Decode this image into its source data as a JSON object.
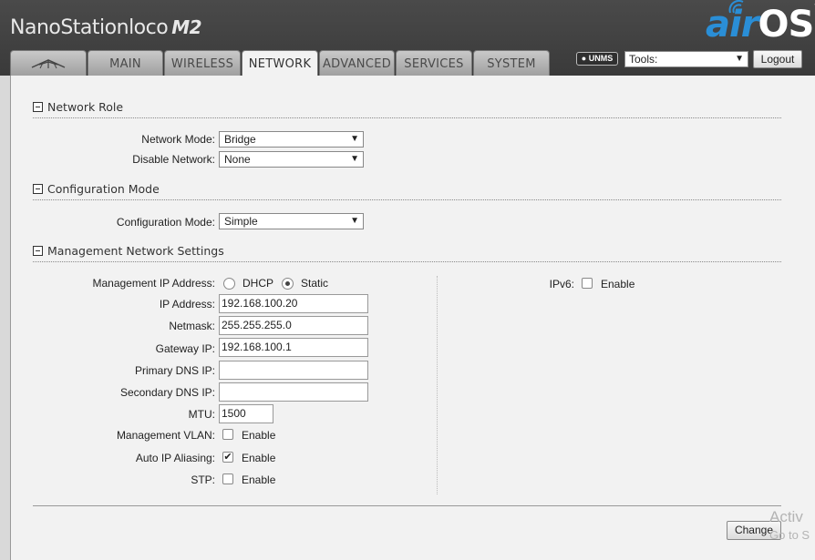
{
  "header": {
    "product_name": "NanoStation",
    "product_variant": "loco",
    "product_model": "M2",
    "brand_air": "air",
    "brand_os": "OS",
    "brand_tm": "™"
  },
  "tabs": [
    {
      "label": "",
      "icon": "ubiquiti-logo-icon"
    },
    {
      "label": "MAIN"
    },
    {
      "label": "WIRELESS"
    },
    {
      "label": "NETWORK",
      "active": true
    },
    {
      "label": "ADVANCED"
    },
    {
      "label": "SERVICES"
    },
    {
      "label": "SYSTEM"
    }
  ],
  "toolbar": {
    "unms_label": "UNMS",
    "tools_value": "Tools:",
    "logout_label": "Logout"
  },
  "network_role": {
    "title": "Network Role",
    "network_mode_label": "Network Mode:",
    "network_mode_value": "Bridge",
    "disable_network_label": "Disable Network:",
    "disable_network_value": "None"
  },
  "configuration_mode": {
    "title": "Configuration Mode",
    "mode_label": "Configuration Mode:",
    "mode_value": "Simple"
  },
  "management": {
    "title": "Management Network Settings",
    "mgmt_ip_label": "Management IP Address:",
    "dhcp_label": "DHCP",
    "static_label": "Static",
    "selected_mode": "Static",
    "ip_label": "IP Address:",
    "ip_value": "192.168.100.20",
    "netmask_label": "Netmask:",
    "netmask_value": "255.255.255.0",
    "gateway_label": "Gateway IP:",
    "gateway_value": "192.168.100.1",
    "primary_dns_label": "Primary DNS IP:",
    "primary_dns_value": "",
    "secondary_dns_label": "Secondary DNS IP:",
    "secondary_dns_value": "",
    "mtu_label": "MTU:",
    "mtu_value": "1500",
    "vlan_label": "Management VLAN:",
    "vlan_enable": "Enable",
    "vlan_checked": false,
    "aliasing_label": "Auto IP Aliasing:",
    "aliasing_enable": "Enable",
    "aliasing_checked": true,
    "stp_label": "STP:",
    "stp_enable": "Enable",
    "stp_checked": false,
    "ipv6_label": "IPv6:",
    "ipv6_enable": "Enable",
    "ipv6_checked": false
  },
  "footer": {
    "change_label": "Change"
  },
  "watermark": {
    "line1": "Activ",
    "line2": "Go to S"
  },
  "colors": {
    "header_bg": "#3f3f3f",
    "brand_blue": "#2a8ed6",
    "panel_bg": "#f2f2f2"
  }
}
